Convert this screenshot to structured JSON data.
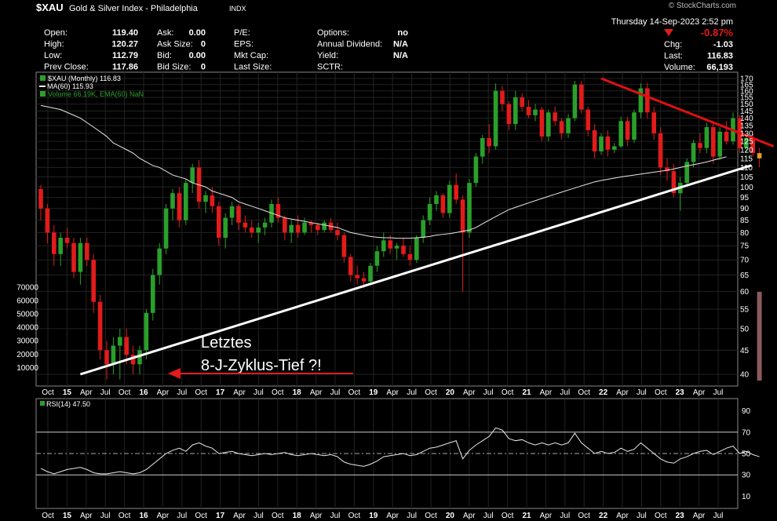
{
  "header": {
    "symbol": "$XAU",
    "name": "Gold & Silver Index - Philadelphia",
    "exchange": "INDX",
    "brand": "© StockCharts.com",
    "datetime": "Thursday  14-Sep-2023  2:52 pm",
    "change_pct": "-0.87%",
    "quote_rows": [
      [
        {
          "l": "Open:",
          "v": "119.40"
        },
        {
          "l": "Ask:",
          "v": "0.00"
        },
        {
          "l": "P/E:",
          "v": ""
        },
        {
          "l": "Options:",
          "v": "no"
        }
      ],
      [
        {
          "l": "High:",
          "v": "120.27"
        },
        {
          "l": "Ask Size:",
          "v": "0"
        },
        {
          "l": "EPS:",
          "v": ""
        },
        {
          "l": "Annual Dividend:",
          "v": "N/A"
        }
      ],
      [
        {
          "l": "Low:",
          "v": "112.79"
        },
        {
          "l": "Bid:",
          "v": "0.00"
        },
        {
          "l": "Mkt Cap:",
          "v": ""
        },
        {
          "l": "Yield:",
          "v": "N/A"
        }
      ],
      [
        {
          "l": "Prev Close:",
          "v": "117.86"
        },
        {
          "l": "Bid Size:",
          "v": "0"
        },
        {
          "l": "Last Size:",
          "v": ""
        },
        {
          "l": "SCTR:",
          "v": ""
        }
      ]
    ],
    "right_rows": [
      {
        "l": "Chg:",
        "v": "-1.03"
      },
      {
        "l": "Last:",
        "v": "116.83"
      },
      {
        "l": "Volume:",
        "v": "66,193"
      }
    ]
  },
  "legend": {
    "price": "$XAU (Monthly) 116.83",
    "ma": "MA(60) 115.93",
    "volume": "Volume 66.19K, EMA(60) NaN",
    "rsi": "RSI(14) 47.50"
  },
  "annotation": {
    "line1": "Letztes",
    "line2": "8-J-Zyklus-Tief ?!"
  },
  "colors": {
    "up": "#2aa02a",
    "down": "#e21b1b",
    "ma": "#e8e8e8",
    "trend_support": "#ffffff",
    "trend_resistance": "#e01010",
    "volume_bar": "#8a5a5a",
    "highlight": "#e0a020"
  },
  "chart_data": {
    "type": "candlestick",
    "price_ticks": [
      40,
      45,
      50,
      55,
      60,
      65,
      70,
      75,
      80,
      85,
      90,
      95,
      100,
      105,
      110,
      115,
      120,
      125,
      130,
      135,
      140,
      145,
      150,
      155,
      160,
      165,
      170
    ],
    "volume_ticks": [
      "10000",
      "20000",
      "30000",
      "40000",
      "50000",
      "60000",
      "70000"
    ],
    "rsi_ticks": [
      10,
      30,
      50,
      70,
      90
    ],
    "x_ticks": [
      "Oct",
      "15",
      "Apr",
      "Jul",
      "Oct",
      "16",
      "Apr",
      "Jul",
      "Oct",
      "17",
      "Apr",
      "Jul",
      "Oct",
      "18",
      "Apr",
      "Jul",
      "Oct",
      "19",
      "Apr",
      "Jul",
      "Oct",
      "20",
      "Apr",
      "Jul",
      "Oct",
      "21",
      "Apr",
      "Jul",
      "Oct",
      "22",
      "Apr",
      "Jul",
      "Oct",
      "23",
      "Apr",
      "Jul"
    ],
    "candles": [
      [
        99,
        101,
        85,
        90
      ],
      [
        90,
        92,
        76,
        80
      ],
      [
        80,
        83,
        68,
        72
      ],
      [
        72,
        80,
        68,
        78
      ],
      [
        78,
        82,
        74,
        76
      ],
      [
        76,
        78,
        64,
        66
      ],
      [
        66,
        78,
        62,
        76
      ],
      [
        76,
        78,
        68,
        70
      ],
      [
        70,
        72,
        54,
        57
      ],
      [
        57,
        59,
        43,
        45
      ],
      [
        45,
        47,
        39,
        42
      ],
      [
        42,
        48,
        40,
        46
      ],
      [
        46,
        50,
        39,
        48
      ],
      [
        48,
        50,
        42,
        44
      ],
      [
        44,
        46,
        40,
        42
      ],
      [
        42,
        46,
        40,
        45
      ],
      [
        45,
        55,
        43,
        54
      ],
      [
        54,
        67,
        52,
        65
      ],
      [
        65,
        76,
        62,
        74
      ],
      [
        74,
        92,
        72,
        90
      ],
      [
        90,
        99,
        85,
        97
      ],
      [
        97,
        100,
        82,
        85
      ],
      [
        85,
        104,
        83,
        102
      ],
      [
        102,
        112,
        97,
        110
      ],
      [
        110,
        114,
        90,
        93
      ],
      [
        93,
        98,
        88,
        96
      ],
      [
        96,
        100,
        88,
        91
      ],
      [
        91,
        93,
        75,
        78
      ],
      [
        78,
        88,
        74,
        86
      ],
      [
        86,
        93,
        83,
        91
      ],
      [
        91,
        92,
        81,
        84
      ],
      [
        84,
        87,
        80,
        82
      ],
      [
        82,
        85,
        78,
        80
      ],
      [
        80,
        84,
        76,
        82
      ],
      [
        82,
        86,
        79,
        84
      ],
      [
        84,
        94,
        82,
        92
      ],
      [
        92,
        95,
        84,
        86
      ],
      [
        86,
        87,
        77,
        80
      ],
      [
        80,
        85,
        76,
        83
      ],
      [
        83,
        87,
        78,
        80
      ],
      [
        80,
        86,
        79,
        84
      ],
      [
        84,
        85,
        80,
        83
      ],
      [
        83,
        84,
        79,
        81
      ],
      [
        81,
        85,
        80,
        84
      ],
      [
        84,
        86,
        80,
        81
      ],
      [
        81,
        84,
        77,
        79
      ],
      [
        79,
        80,
        69,
        71
      ],
      [
        71,
        72,
        63,
        65
      ],
      [
        65,
        68,
        62,
        64
      ],
      [
        64,
        66,
        61,
        63
      ],
      [
        63,
        69,
        62,
        68
      ],
      [
        68,
        75,
        66,
        73
      ],
      [
        73,
        80,
        71,
        77
      ],
      [
        77,
        79,
        72,
        74
      ],
      [
        74,
        76,
        70,
        75
      ],
      [
        75,
        78,
        71,
        72
      ],
      [
        72,
        75,
        68,
        70
      ],
      [
        70,
        79,
        69,
        78
      ],
      [
        78,
        87,
        76,
        85
      ],
      [
        85,
        95,
        83,
        92
      ],
      [
        92,
        98,
        89,
        96
      ],
      [
        96,
        97,
        86,
        88
      ],
      [
        88,
        103,
        86,
        101
      ],
      [
        101,
        107,
        92,
        94
      ],
      [
        94,
        96,
        60,
        80
      ],
      [
        80,
        104,
        78,
        102
      ],
      [
        102,
        118,
        100,
        116
      ],
      [
        116,
        129,
        112,
        127
      ],
      [
        127,
        136,
        118,
        122
      ],
      [
        122,
        166,
        120,
        160
      ],
      [
        160,
        164,
        145,
        150
      ],
      [
        150,
        152,
        132,
        136
      ],
      [
        136,
        160,
        132,
        155
      ],
      [
        155,
        158,
        145,
        148
      ],
      [
        148,
        153,
        140,
        142
      ],
      [
        142,
        150,
        138,
        146
      ],
      [
        146,
        148,
        125,
        128
      ],
      [
        128,
        146,
        125,
        144
      ],
      [
        144,
        148,
        135,
        138
      ],
      [
        138,
        140,
        126,
        130
      ],
      [
        130,
        143,
        127,
        140
      ],
      [
        140,
        168,
        138,
        165
      ],
      [
        165,
        168,
        143,
        146
      ],
      [
        146,
        148,
        128,
        132
      ],
      [
        132,
        136,
        115,
        119
      ],
      [
        119,
        130,
        117,
        128
      ],
      [
        128,
        132,
        116,
        120
      ],
      [
        120,
        124,
        118,
        122
      ],
      [
        122,
        141,
        121,
        138
      ],
      [
        138,
        141,
        122,
        126
      ],
      [
        126,
        146,
        124,
        144
      ],
      [
        144,
        166,
        140,
        162
      ],
      [
        162,
        166,
        140,
        144
      ],
      [
        144,
        148,
        126,
        130
      ],
      [
        130,
        134,
        106,
        110
      ],
      [
        110,
        115,
        103,
        108
      ],
      [
        108,
        112,
        95,
        97
      ],
      [
        97,
        105,
        89,
        102
      ],
      [
        102,
        115,
        100,
        113
      ],
      [
        113,
        126,
        110,
        124
      ],
      [
        124,
        130,
        118,
        121
      ],
      [
        121,
        137,
        118,
        134
      ],
      [
        134,
        137,
        112,
        116
      ],
      [
        116,
        134,
        114,
        131
      ],
      [
        131,
        138,
        123,
        125
      ],
      [
        125,
        144,
        123,
        140
      ],
      [
        140,
        142,
        118,
        121
      ],
      [
        121,
        130,
        118,
        127
      ],
      [
        127,
        130,
        116,
        118
      ],
      [
        118,
        121,
        110,
        115
      ]
    ],
    "ma60": [
      [
        0,
        149
      ],
      [
        1,
        148
      ],
      [
        2,
        147
      ],
      [
        3,
        146
      ],
      [
        4,
        144
      ],
      [
        5,
        142
      ],
      [
        6,
        140
      ],
      [
        7,
        137
      ],
      [
        8,
        134
      ],
      [
        9,
        131
      ],
      [
        10,
        128
      ],
      [
        11,
        124
      ],
      [
        12,
        122
      ],
      [
        13,
        120
      ],
      [
        14,
        118
      ],
      [
        15,
        115
      ],
      [
        16,
        113
      ],
      [
        17,
        111
      ],
      [
        18,
        110
      ],
      [
        19,
        108
      ],
      [
        20,
        106
      ],
      [
        21,
        105
      ],
      [
        22,
        104
      ],
      [
        23,
        102
      ],
      [
        24,
        101
      ],
      [
        25,
        100
      ],
      [
        26,
        98
      ],
      [
        27,
        97
      ],
      [
        28,
        96
      ],
      [
        29,
        95
      ],
      [
        30,
        93
      ],
      [
        31,
        92
      ],
      [
        32,
        91
      ],
      [
        33,
        90
      ],
      [
        34,
        89
      ],
      [
        35,
        88
      ],
      [
        36,
        87
      ],
      [
        37,
        86
      ],
      [
        38,
        85.5
      ],
      [
        39,
        85
      ],
      [
        40,
        84.5
      ],
      [
        41,
        84
      ],
      [
        42,
        83.5
      ],
      [
        43,
        83
      ],
      [
        44,
        82.5
      ],
      [
        45,
        82
      ],
      [
        46,
        81
      ],
      [
        47,
        80
      ],
      [
        48,
        79.5
      ],
      [
        49,
        79
      ],
      [
        50,
        78.5
      ],
      [
        51,
        78.2
      ],
      [
        52,
        78
      ],
      [
        53,
        78
      ],
      [
        54,
        77.8
      ],
      [
        55,
        77.8
      ],
      [
        56,
        77.8
      ],
      [
        57,
        78
      ],
      [
        58,
        78.2
      ],
      [
        59,
        78.5
      ],
      [
        60,
        79
      ],
      [
        61,
        79.3
      ],
      [
        62,
        79.6
      ],
      [
        63,
        80
      ],
      [
        64,
        80.5
      ],
      [
        65,
        81
      ],
      [
        66,
        82
      ],
      [
        67,
        83.5
      ],
      [
        68,
        85
      ],
      [
        69,
        86.5
      ],
      [
        70,
        88
      ],
      [
        71,
        89.5
      ],
      [
        72,
        90.5
      ],
      [
        73,
        91.5
      ],
      [
        74,
        92.5
      ],
      [
        75,
        93.5
      ],
      [
        76,
        94.5
      ],
      [
        77,
        95.5
      ],
      [
        78,
        96.5
      ],
      [
        79,
        97.5
      ],
      [
        80,
        98.5
      ],
      [
        81,
        99.5
      ],
      [
        82,
        100.5
      ],
      [
        83,
        101.5
      ],
      [
        84,
        102.5
      ],
      [
        85,
        103.2
      ],
      [
        86,
        103.8
      ],
      [
        87,
        104.4
      ],
      [
        88,
        105
      ],
      [
        89,
        105.5
      ],
      [
        90,
        106
      ],
      [
        91,
        106.5
      ],
      [
        92,
        107
      ],
      [
        93,
        107.5
      ],
      [
        94,
        108
      ],
      [
        95,
        108.5
      ],
      [
        96,
        109.2
      ],
      [
        97,
        110
      ],
      [
        98,
        110.8
      ],
      [
        99,
        111.5
      ],
      [
        100,
        112.2
      ],
      [
        101,
        113
      ],
      [
        102,
        114
      ],
      [
        103,
        115
      ],
      [
        104,
        115.9
      ]
    ],
    "trend_support": [
      [
        6,
        40
      ],
      [
        103,
        109
      ]
    ],
    "trend_resistance": [
      [
        85,
        170
      ],
      [
        104,
        122
      ]
    ],
    "volume_last": 66193,
    "rsi": [
      36,
      33,
      31,
      33,
      35,
      36,
      37,
      35,
      32,
      31,
      31,
      32,
      33,
      32,
      31,
      32,
      35,
      40,
      45,
      50,
      53,
      55,
      52,
      58,
      60,
      57,
      55,
      50,
      51,
      52,
      50,
      49,
      48,
      49,
      50,
      49,
      50,
      51,
      49,
      48,
      49,
      50,
      49,
      48,
      49,
      47,
      42,
      40,
      39,
      38,
      40,
      43,
      47,
      48,
      49,
      50,
      48,
      49,
      52,
      55,
      56,
      58,
      60,
      62,
      45,
      53,
      58,
      62,
      66,
      74,
      72,
      64,
      62,
      63,
      60,
      58,
      60,
      58,
      60,
      58,
      60,
      69,
      60,
      55,
      50,
      52,
      50,
      51,
      55,
      52,
      54,
      60,
      55,
      50,
      45,
      42,
      41,
      45,
      47,
      50,
      52,
      53,
      49,
      52,
      55,
      57,
      50,
      52,
      49,
      47
    ]
  }
}
